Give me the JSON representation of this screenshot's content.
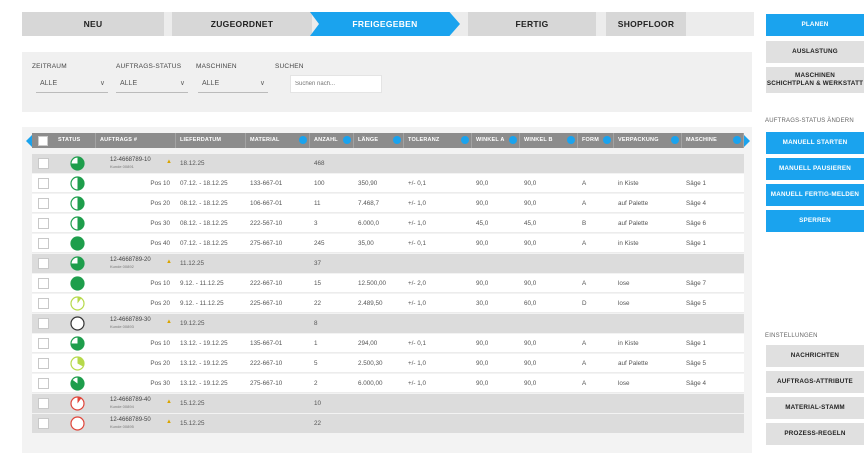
{
  "stepper": {
    "steps": [
      {
        "label": "NEU",
        "active": false
      },
      {
        "label": "ZUGEORDNET",
        "active": false
      },
      {
        "label": "FREIGEGEBEN",
        "active": true
      },
      {
        "label": "FERTIG",
        "active": false
      },
      {
        "label": "SHOPFLOOR",
        "active": false
      }
    ]
  },
  "filters": {
    "zeitraum": {
      "label": "ZEITRAUM",
      "value": "ALLE"
    },
    "auftrag_status": {
      "label": "AUFTRAGS-STATUS",
      "value": "ALLE"
    },
    "maschinen": {
      "label": "MASCHINEN",
      "value": "ALLE"
    },
    "suchen": {
      "label": "SUCHEN",
      "placeholder": "Suchen nach..."
    },
    "caret": "∨"
  },
  "table": {
    "columns": [
      "STATUS",
      "AUFTRAGS #",
      "LIEFERDATUM",
      "MATERIAL",
      "ANZAHL",
      "LÄNGE",
      "TOLERANZ",
      "WINKEL A",
      "WINKEL B",
      "FORM",
      "VERPACKUNG",
      "MASCHINE"
    ],
    "rows": [
      {
        "type": "group",
        "status": "q75",
        "color": "green",
        "order": "12-4668789-10",
        "sub": "Kunde 00891",
        "date": "18.12.25",
        "qty": "468"
      },
      {
        "type": "item",
        "status": "q50",
        "color": "green",
        "pos": "Pos 10",
        "date": "07.12. - 18.12.25",
        "material": "133-667-01",
        "qty": "100",
        "len": "350,90",
        "tol": "+/- 0,1",
        "wa": "90,0",
        "wb": "90,0",
        "form": "A",
        "pack": "in Kiste",
        "machine": "Säge 1"
      },
      {
        "type": "item",
        "status": "q50",
        "color": "green",
        "pos": "Pos 20",
        "date": "08.12. - 18.12.25",
        "material": "106-667-01",
        "qty": "11",
        "len": "7.468,7",
        "tol": "+/- 1,0",
        "wa": "90,0",
        "wb": "90,0",
        "form": "A",
        "pack": "auf Palette",
        "machine": "Säge 4"
      },
      {
        "type": "item",
        "status": "q50",
        "color": "green",
        "pos": "Pos 30",
        "date": "08.12. - 18.12.25",
        "material": "222-567-10",
        "qty": "3",
        "len": "6.000,0",
        "tol": "+/- 1,0",
        "wa": "45,0",
        "wb": "45,0",
        "form": "B",
        "pack": "auf Palette",
        "machine": "Säge 6"
      },
      {
        "type": "item",
        "status": "full",
        "color": "green",
        "pos": "Pos 40",
        "date": "07.12. - 18.12.25",
        "material": "275-667-10",
        "qty": "245",
        "len": "35,00",
        "tol": "+/- 0,1",
        "wa": "90,0",
        "wb": "90,0",
        "form": "A",
        "pack": "in Kiste",
        "machine": "Säge 1"
      },
      {
        "type": "group",
        "status": "q75",
        "color": "green",
        "order": "12-4668789-20",
        "sub": "Kunde 00892",
        "date": "11.12.25",
        "qty": "37"
      },
      {
        "type": "item",
        "status": "full",
        "color": "green",
        "pos": "Pos 10",
        "date": "9.12. - 11.12.25",
        "material": "222-667-10",
        "qty": "15",
        "len": "12.500,00",
        "tol": "+/- 2,0",
        "wa": "90,0",
        "wb": "90,0",
        "form": "A",
        "pack": "lose",
        "machine": "Säge 7"
      },
      {
        "type": "item",
        "status": "q10",
        "color": "lime",
        "pos": "Pos 20",
        "date": "9.12. - 11.12.25",
        "material": "225-667-10",
        "qty": "22",
        "len": "2.489,50",
        "tol": "+/- 1,0",
        "wa": "30,0",
        "wb": "60,0",
        "form": "D",
        "pack": "lose",
        "machine": "Säge 5"
      },
      {
        "type": "group",
        "status": "empty",
        "color": "dark",
        "order": "12-4668789-30",
        "sub": "Kunde 00893",
        "date": "19.12.25",
        "qty": "8"
      },
      {
        "type": "item",
        "status": "q75",
        "color": "green",
        "pos": "Pos 10",
        "date": "13.12. - 19.12.25",
        "material": "135-667-01",
        "qty": "1",
        "len": "294,00",
        "tol": "+/- 0,1",
        "wa": "90,0",
        "wb": "90,0",
        "form": "A",
        "pack": "in Kiste",
        "machine": "Säge 1"
      },
      {
        "type": "item",
        "status": "q33",
        "color": "lime",
        "pos": "Pos 20",
        "date": "13.12. - 19.12.25",
        "material": "222-667-10",
        "qty": "5",
        "len": "2.500,30",
        "tol": "+/- 1,0",
        "wa": "90,0",
        "wb": "90,0",
        "form": "A",
        "pack": "auf Palette",
        "machine": "Säge 5"
      },
      {
        "type": "item",
        "status": "q80",
        "color": "green",
        "pos": "Pos 30",
        "date": "13.12. - 19.12.25",
        "material": "275-667-10",
        "qty": "2",
        "len": "6.000,00",
        "tol": "+/- 1,0",
        "wa": "90,0",
        "wb": "90,0",
        "form": "A",
        "pack": "lose",
        "machine": "Säge 4"
      },
      {
        "type": "group",
        "status": "q10",
        "color": "red",
        "order": "12-4668789-40",
        "sub": "Kunde 00894",
        "date": "15.12.25",
        "qty": "10"
      },
      {
        "type": "group",
        "status": "empty",
        "color": "red",
        "order": "12-4668789-50",
        "sub": "Kunde 00895",
        "date": "15.12.25",
        "qty": "22"
      }
    ]
  },
  "right_panel": {
    "primary": [
      {
        "label": "PLANEN",
        "style": "blue"
      },
      {
        "label": "AUSLASTUNG",
        "style": "grey"
      },
      {
        "label": "MASCHINEN",
        "label2": "SCHICHTPLAN & WERKSTATT",
        "style": "grey"
      }
    ],
    "status_section_label": "AUFTRAGS-STATUS ÄNDERN",
    "status_actions": [
      {
        "label": "MANUELL STARTEN"
      },
      {
        "label": "MANUELL PAUSIEREN"
      },
      {
        "label": "MANUELL FERTIG-MELDEN"
      },
      {
        "label": "SPERREN"
      }
    ],
    "settings_section_label": "EINSTELLUNGEN",
    "settings": [
      {
        "label": "NACHRICHTEN"
      },
      {
        "label": "AUFTRAGS-ATTRIBUTE"
      },
      {
        "label": "MATERIAL-STAMM"
      },
      {
        "label": "PROZESS-REGELN"
      }
    ]
  },
  "colors": {
    "accent": "#1aa3ee",
    "green": "#1e9e4c",
    "lime": "#b6d94a",
    "red": "#e0453a",
    "dark": "#333333"
  }
}
